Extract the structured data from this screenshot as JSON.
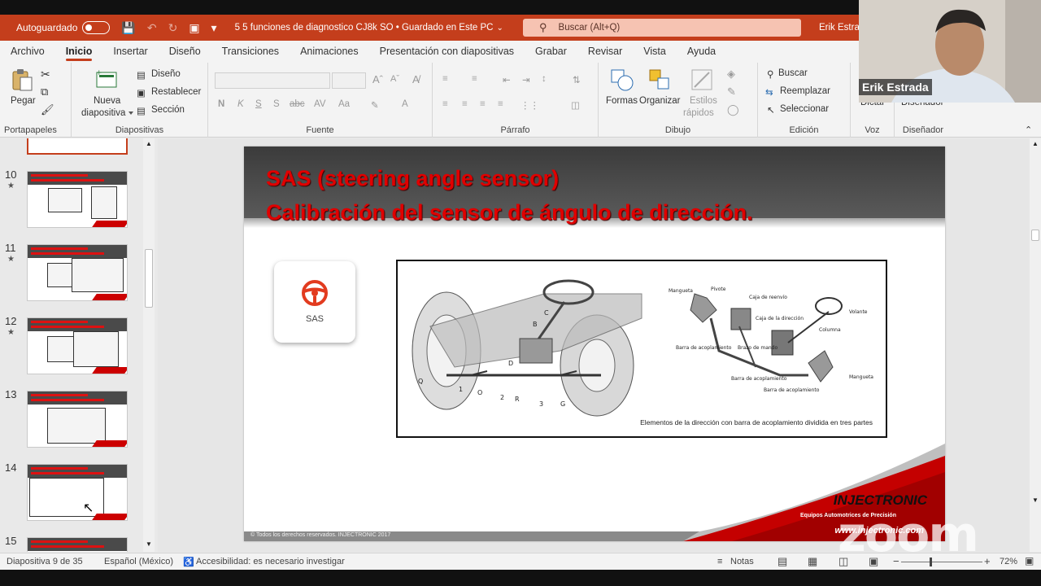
{
  "titlebar": {
    "autosave_label": "Autoguardado",
    "doc_title": "5 5 funciones de diagnostico CJ8k SO • Guardado en Este PC",
    "search_placeholder": "Buscar (Alt+Q)",
    "user_name": "Erik Estrac"
  },
  "tabs": [
    {
      "label": "Archivo"
    },
    {
      "label": "Inicio",
      "active": true
    },
    {
      "label": "Insertar"
    },
    {
      "label": "Diseño"
    },
    {
      "label": "Transiciones"
    },
    {
      "label": "Animaciones"
    },
    {
      "label": "Presentación con diapositivas"
    },
    {
      "label": "Grabar"
    },
    {
      "label": "Revisar"
    },
    {
      "label": "Vista"
    },
    {
      "label": "Ayuda"
    }
  ],
  "ribbon": {
    "portapapeles": {
      "label": "Portapapeles",
      "pegar": "Pegar"
    },
    "diapositivas": {
      "label": "Diapositivas",
      "nueva_1": "Nueva",
      "nueva_2": "diapositiva",
      "diseno": "Diseño",
      "restablecer": "Restablecer",
      "seccion": "Sección"
    },
    "fuente": {
      "label": "Fuente"
    },
    "parrafo": {
      "label": "Párrafo"
    },
    "dibujo": {
      "label": "Dibujo",
      "formas": "Formas",
      "organizar": "Organizar",
      "estilos_1": "Estilos",
      "estilos_2": "rápidos"
    },
    "edicion": {
      "label": "Edición",
      "buscar": "Buscar",
      "reemplazar": "Reemplazar",
      "seleccionar": "Seleccionar"
    },
    "voz": {
      "label": "Voz",
      "dictar": "Dictar"
    },
    "disenador": {
      "label": "Diseñador",
      "btn": "Diseñador"
    }
  },
  "thumbnails": [
    {
      "num": "10",
      "starred": true
    },
    {
      "num": "11",
      "starred": true
    },
    {
      "num": "12",
      "starred": true
    },
    {
      "num": "13",
      "starred": false
    },
    {
      "num": "14",
      "starred": false
    },
    {
      "num": "15",
      "starred": false
    }
  ],
  "slide": {
    "title_line1": "SAS (steering angle sensor)",
    "title_line2": "Calibración del sensor de ángulo de dirección.",
    "card_label": "SAS",
    "figure_caption": "Elementos de la dirección con barra de acoplamiento dividida en tres partes",
    "figure_labels": {
      "mangueta": "Mangueta",
      "pivote": "Pivote",
      "caja_reenvio": "Caja de reenvío",
      "caja_direccion": "Caja de la dirección",
      "volante": "Volante",
      "columna": "Columna",
      "barra_acopl_1": "Barra de acoplamiento",
      "brazo_mando": "Brazo de mando",
      "barra_acopl_2": "Barra de acoplamiento",
      "barra_acopl_3": "Barra de acoplamiento",
      "mangueta_2": "Mangueta"
    },
    "copyright": "© Todos los derechos reservados. INJECTRONIC 2017",
    "brand": "INJECTRONIC",
    "brand_sub": "Equipos Automotrices de Precisión",
    "brand_url": "www.injectronic.com"
  },
  "status": {
    "slide_info": "Diapositiva 9 de 35",
    "language": "Español (México)",
    "accessibility": "Accesibilidad: es necesario investigar",
    "notes": "Notas",
    "zoom": "72%"
  },
  "webcam": {
    "name": "Erik Estrada",
    "watermark": "zoom"
  },
  "colors": {
    "accent": "#c43e1c",
    "slide_red": "#e00000"
  }
}
